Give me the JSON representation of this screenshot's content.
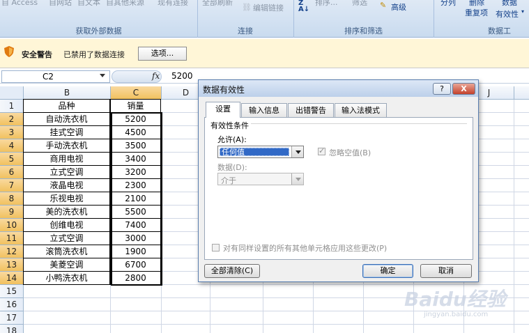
{
  "ribbon": {
    "items_top": [
      "自 Access",
      "自网站",
      "自文本",
      "自其他来源",
      "现有连接",
      "全部刷新",
      "编辑链接",
      "排序...",
      "筛选",
      "高级",
      "分列",
      "删除",
      "数据"
    ],
    "edit_links": "编辑链接",
    "advanced": "高级",
    "dup": "重复项",
    "validity": "有效性",
    "groups": [
      "获取外部数据",
      "连接",
      "排序和筛选",
      "数据工"
    ]
  },
  "security": {
    "title": "安全警告",
    "message": "已禁用了数据连接",
    "options_button": "选项..."
  },
  "formula_bar": {
    "name_box": "C2",
    "fx": "fx",
    "value": "5200"
  },
  "sheet": {
    "columns": [
      "B",
      "C",
      "D",
      "J"
    ],
    "rows": [
      "1",
      "2",
      "3",
      "4",
      "5",
      "6",
      "7",
      "8",
      "9",
      "10",
      "11",
      "12",
      "13",
      "14",
      "15",
      "16",
      "17",
      "18"
    ],
    "header": [
      "品种",
      "销量"
    ],
    "data": [
      [
        "自动洗衣机",
        "5200"
      ],
      [
        "挂式空调",
        "4500"
      ],
      [
        "手动洗衣机",
        "3500"
      ],
      [
        "商用电视",
        "3400"
      ],
      [
        "立式空调",
        "3200"
      ],
      [
        "液晶电视",
        "2300"
      ],
      [
        "乐视电视",
        "2100"
      ],
      [
        "美的洗衣机",
        "5500"
      ],
      [
        "创维电视",
        "7400"
      ],
      [
        "立式空调",
        "3000"
      ],
      [
        "滚筒洗衣机",
        "1900"
      ],
      [
        "美菱空调",
        "6700"
      ],
      [
        "小鸭洗衣机",
        "2800"
      ]
    ]
  },
  "dialog": {
    "title": "数据有效性",
    "help": "?",
    "close": "X",
    "tabs": [
      "设置",
      "输入信息",
      "出错警告",
      "输入法模式"
    ],
    "group_label": "有效性条件",
    "allow_label": "允许(A):",
    "allow_value": "任何值",
    "ignore_blank": "忽略空值(B)",
    "data_label": "数据(D):",
    "data_value": "介于",
    "apply_all": "对有同样设置的所有其他单元格应用这些更改(P)",
    "clear_all": "全部清除(C)",
    "ok": "确定",
    "cancel": "取消"
  },
  "watermark": {
    "brand": "Baidu经验",
    "url": "jingyan.baidu.com"
  }
}
